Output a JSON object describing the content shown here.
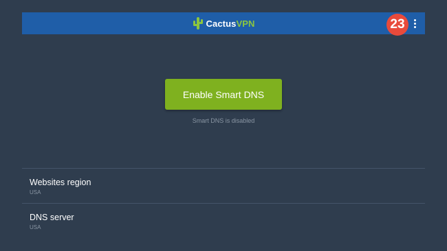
{
  "app": {
    "name_part1": "Cactus",
    "name_part2": "VPN",
    "brand_color": "#1f5ea8",
    "accent_green": "#7fb11f",
    "background": "#2f3d4e",
    "logo_icon": "cactus-icon",
    "menu_icon": "more-vert-icon"
  },
  "annotation": {
    "step_number": "23",
    "color": "#e84a3b"
  },
  "main": {
    "enable_button_label": "Enable Smart DNS",
    "status_text": "Smart DNS is disabled"
  },
  "settings": [
    {
      "title": "Websites region",
      "value": "USA"
    },
    {
      "title": "DNS server",
      "value": "USA"
    }
  ]
}
